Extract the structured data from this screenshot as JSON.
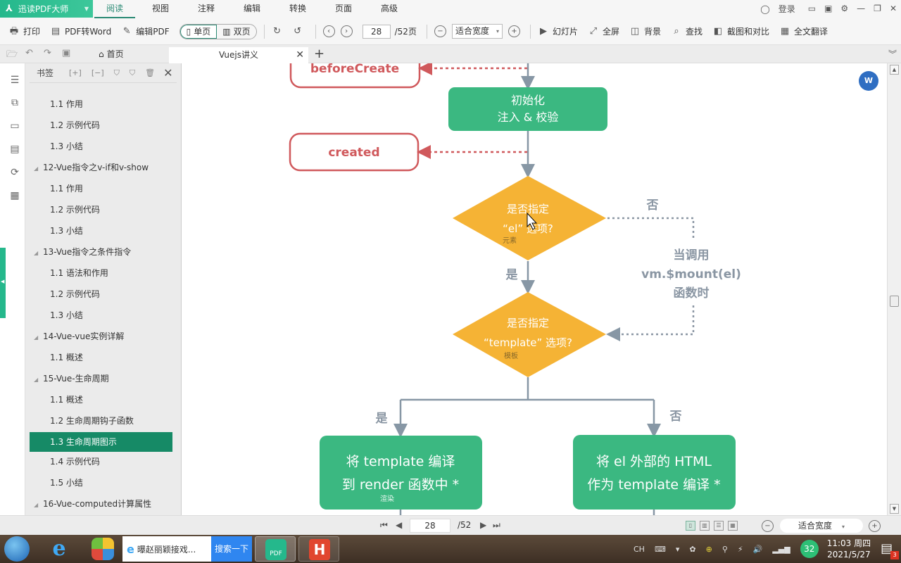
{
  "app": {
    "name": "迅读PDF大师",
    "menu_tabs": [
      "阅读",
      "视图",
      "注释",
      "编辑",
      "转换",
      "页面",
      "高级"
    ],
    "active_menu_tab": "阅读",
    "login_label": "登录"
  },
  "toolbar": {
    "print": "打印",
    "pdf_to_word": "PDF转Word",
    "edit_pdf": "编辑PDF",
    "single_page": "单页",
    "double_page": "双页",
    "current_page": "28",
    "total_pages": "/52页",
    "zoom_mode": "适合宽度",
    "slideshow": "幻灯片",
    "fullscreen": "全屏",
    "background": "背景",
    "find": "查找",
    "screenshot_compare": "截图和对比",
    "translate": "全文翻译"
  },
  "tabs": {
    "home": "首页",
    "document": "Vuejs讲义"
  },
  "bookmarks": {
    "title": "书签",
    "items": [
      {
        "label": "1.1 作用",
        "level": 2
      },
      {
        "label": "1.2 示例代码",
        "level": 2
      },
      {
        "label": "1.3 小结",
        "level": 2
      },
      {
        "label": "12-Vue指令之v-if和v-show",
        "level": 1
      },
      {
        "label": "1.1 作用",
        "level": 2
      },
      {
        "label": "1.2 示例代码",
        "level": 2
      },
      {
        "label": "1.3 小结",
        "level": 2
      },
      {
        "label": "13-Vue指令之条件指令",
        "level": 1
      },
      {
        "label": "1.1 语法和作用",
        "level": 2
      },
      {
        "label": "1.2 示例代码",
        "level": 2
      },
      {
        "label": "1.3 小结",
        "level": 2
      },
      {
        "label": "14-Vue-vue实例详解",
        "level": 1
      },
      {
        "label": "1.1 概述",
        "level": 2
      },
      {
        "label": "15-Vue-生命周期",
        "level": 1
      },
      {
        "label": "1.1 概述",
        "level": 2
      },
      {
        "label": "1.2 生命周期钩子函数",
        "level": 2
      },
      {
        "label": "1.3 生命周期图示",
        "level": 2,
        "selected": true
      },
      {
        "label": "1.4 示例代码",
        "level": 2
      },
      {
        "label": "1.5 小结",
        "level": 2
      },
      {
        "label": "16-Vue-computed计算属性",
        "level": 1
      }
    ]
  },
  "diagram": {
    "hook_before_create": "beforeCreate",
    "hook_created": "created",
    "init_line1": "初始化",
    "init_line2": "注入 & 校验",
    "q_el_line1": "是否指定",
    "q_el_line2": "“el” 选项?",
    "q_el_note": "元素",
    "q_tpl_line1": "是否指定",
    "q_tpl_line2": "“template” 选项?",
    "q_tpl_note": "模板",
    "yes": "是",
    "no": "否",
    "mount_line1": "当调用",
    "mount_line2": "vm.$mount(el)",
    "mount_line3": "函数时",
    "compile_tpl_line1": "将 template 编译",
    "compile_tpl_line2": "到 render 函数中 *",
    "compile_tpl_note": "渲染",
    "compile_el_line1": "将 el 外部的 HTML",
    "compile_el_line2": "作为 template 编译 *",
    "colors": {
      "green": "#3bb881",
      "orange": "#f5b335",
      "hook_red": "#d0595c",
      "line_gray": "#8797a5",
      "text_gray": "#8a96a3"
    }
  },
  "statusbar": {
    "current_page": "28",
    "total_pages": "/52",
    "zoom_mode": "适合宽度"
  },
  "taskbar": {
    "ie_search_query": "曝赵丽颖接戏...",
    "ie_search_button": "搜索一下",
    "pdf_label": "PDF",
    "h_label": "H",
    "ime": "CH",
    "badge_num": "32",
    "time": "11:03 周四",
    "date": "2021/5/27",
    "notification_count": "3"
  }
}
